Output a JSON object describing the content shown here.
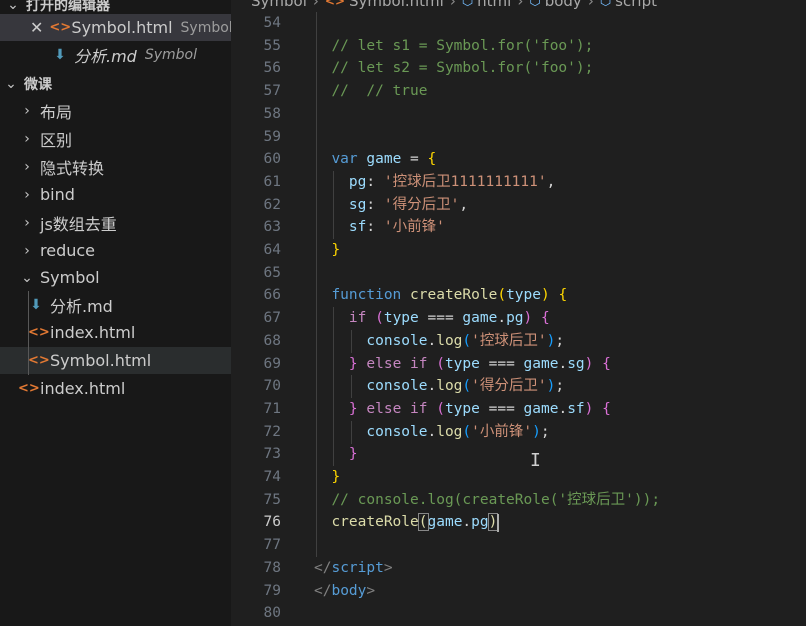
{
  "sidebar": {
    "open_editors_title": "打开的编辑器",
    "open_editors": [
      {
        "icon": "close-icon",
        "type_icon": "html-file-icon",
        "name": "Symbol.html",
        "folder": "Symbol"
      },
      {
        "type_icon": "markdown-file-icon",
        "name": "分析.md",
        "folder": "Symbol"
      }
    ],
    "workspace_title": "微课",
    "tree": [
      {
        "kind": "folder",
        "label": "布局",
        "expanded": false
      },
      {
        "kind": "folder",
        "label": "区别",
        "expanded": false
      },
      {
        "kind": "folder",
        "label": "隐式转换",
        "expanded": false
      },
      {
        "kind": "folder",
        "label": "bind",
        "expanded": false
      },
      {
        "kind": "folder",
        "label": "js数组去重",
        "expanded": false
      },
      {
        "kind": "folder",
        "label": "reduce",
        "expanded": false
      },
      {
        "kind": "folder",
        "label": "Symbol",
        "expanded": true
      },
      {
        "kind": "file",
        "icon": "markdown-file-icon",
        "label": "分析.md"
      },
      {
        "kind": "file",
        "icon": "html-file-icon",
        "label": "index.html"
      },
      {
        "kind": "file",
        "icon": "html-file-icon",
        "label": "Symbol.html",
        "selected": true
      },
      {
        "kind": "file",
        "icon": "html-file-icon",
        "label": "index.html"
      }
    ]
  },
  "breadcrumb": [
    "Symbol",
    "Symbol.html",
    "html",
    "body",
    "script"
  ],
  "editor": {
    "current_line": 76,
    "lines": [
      {
        "n": 54,
        "indent": 2,
        "tokens": []
      },
      {
        "n": 55,
        "indent": 2,
        "tokens": [
          [
            "com",
            "// let s1 = Symbol.for('foo');"
          ]
        ]
      },
      {
        "n": 56,
        "indent": 2,
        "tokens": [
          [
            "com",
            "// let s2 = Symbol.for('foo');"
          ]
        ]
      },
      {
        "n": 57,
        "indent": 2,
        "tokens": [
          [
            "com",
            "//  // true"
          ]
        ]
      },
      {
        "n": 58,
        "indent": 2,
        "tokens": []
      },
      {
        "n": 59,
        "indent": 2,
        "tokens": []
      },
      {
        "n": 60,
        "indent": 2,
        "tokens": [
          [
            "kw",
            "var"
          ],
          [
            "pun",
            " "
          ],
          [
            "var",
            "game"
          ],
          [
            "pun",
            " = "
          ],
          [
            "b1",
            "{"
          ]
        ]
      },
      {
        "n": 61,
        "indent": 3,
        "tokens": [
          [
            "var",
            "pg"
          ],
          [
            "pun",
            ": "
          ],
          [
            "str",
            "'控球后卫1111111111'"
          ],
          [
            "pun",
            ","
          ]
        ]
      },
      {
        "n": 62,
        "indent": 3,
        "tokens": [
          [
            "var",
            "sg"
          ],
          [
            "pun",
            ": "
          ],
          [
            "str",
            "'得分后卫'"
          ],
          [
            "pun",
            ","
          ]
        ]
      },
      {
        "n": 63,
        "indent": 3,
        "tokens": [
          [
            "var",
            "sf"
          ],
          [
            "pun",
            ": "
          ],
          [
            "str",
            "'小前锋'"
          ]
        ]
      },
      {
        "n": 64,
        "indent": 2,
        "tokens": [
          [
            "b1",
            "}"
          ]
        ]
      },
      {
        "n": 65,
        "indent": 2,
        "tokens": []
      },
      {
        "n": 66,
        "indent": 2,
        "tokens": [
          [
            "kw",
            "function"
          ],
          [
            "pun",
            " "
          ],
          [
            "fn",
            "createRole"
          ],
          [
            "b1",
            "("
          ],
          [
            "var",
            "type"
          ],
          [
            "b1",
            ")"
          ],
          [
            "pun",
            " "
          ],
          [
            "b1",
            "{"
          ]
        ]
      },
      {
        "n": 67,
        "indent": 3,
        "tokens": [
          [
            "ctl",
            "if"
          ],
          [
            "pun",
            " "
          ],
          [
            "b2",
            "("
          ],
          [
            "var",
            "type"
          ],
          [
            "pun",
            " === "
          ],
          [
            "var",
            "game"
          ],
          [
            "pun",
            "."
          ],
          [
            "var",
            "pg"
          ],
          [
            "b2",
            ")"
          ],
          [
            "pun",
            " "
          ],
          [
            "b2",
            "{"
          ]
        ]
      },
      {
        "n": 68,
        "indent": 4,
        "tokens": [
          [
            "var",
            "console"
          ],
          [
            "pun",
            "."
          ],
          [
            "fn",
            "log"
          ],
          [
            "b3",
            "("
          ],
          [
            "str",
            "'控球后卫'"
          ],
          [
            "b3",
            ")"
          ],
          [
            "pun",
            ";"
          ]
        ]
      },
      {
        "n": 69,
        "indent": 3,
        "tokens": [
          [
            "b2",
            "}"
          ],
          [
            "pun",
            " "
          ],
          [
            "ctl",
            "else if"
          ],
          [
            "pun",
            " "
          ],
          [
            "b2",
            "("
          ],
          [
            "var",
            "type"
          ],
          [
            "pun",
            " === "
          ],
          [
            "var",
            "game"
          ],
          [
            "pun",
            "."
          ],
          [
            "var",
            "sg"
          ],
          [
            "b2",
            ")"
          ],
          [
            "pun",
            " "
          ],
          [
            "b2",
            "{"
          ]
        ]
      },
      {
        "n": 70,
        "indent": 4,
        "tokens": [
          [
            "var",
            "console"
          ],
          [
            "pun",
            "."
          ],
          [
            "fn",
            "log"
          ],
          [
            "b3",
            "("
          ],
          [
            "str",
            "'得分后卫'"
          ],
          [
            "b3",
            ")"
          ],
          [
            "pun",
            ";"
          ]
        ]
      },
      {
        "n": 71,
        "indent": 3,
        "tokens": [
          [
            "b2",
            "}"
          ],
          [
            "pun",
            " "
          ],
          [
            "ctl",
            "else if"
          ],
          [
            "pun",
            " "
          ],
          [
            "b2",
            "("
          ],
          [
            "var",
            "type"
          ],
          [
            "pun",
            " === "
          ],
          [
            "var",
            "game"
          ],
          [
            "pun",
            "."
          ],
          [
            "var",
            "sf"
          ],
          [
            "b2",
            ")"
          ],
          [
            "pun",
            " "
          ],
          [
            "b2",
            "{"
          ]
        ]
      },
      {
        "n": 72,
        "indent": 4,
        "tokens": [
          [
            "var",
            "console"
          ],
          [
            "pun",
            "."
          ],
          [
            "fn",
            "log"
          ],
          [
            "b3",
            "("
          ],
          [
            "str",
            "'小前锋'"
          ],
          [
            "b3",
            ")"
          ],
          [
            "pun",
            ";"
          ]
        ]
      },
      {
        "n": 73,
        "indent": 3,
        "tokens": [
          [
            "b2",
            "}"
          ]
        ]
      },
      {
        "n": 74,
        "indent": 2,
        "tokens": [
          [
            "b1",
            "}"
          ]
        ]
      },
      {
        "n": 75,
        "indent": 2,
        "tokens": [
          [
            "com",
            "// console.log(createRole('控球后卫'));"
          ]
        ]
      },
      {
        "n": 76,
        "indent": 2,
        "tokens": [
          [
            "fn",
            "createRole"
          ],
          [
            "box",
            "("
          ],
          [
            "var",
            "game"
          ],
          [
            "pun",
            "."
          ],
          [
            "var",
            "pg"
          ],
          [
            "box",
            ")"
          ]
        ]
      },
      {
        "n": 77,
        "indent": 2,
        "tokens": []
      },
      {
        "n": 78,
        "indent": 1,
        "tokens": [
          [
            "tagb",
            "</"
          ],
          [
            "tag",
            "script"
          ],
          [
            "tagb",
            ">"
          ]
        ]
      },
      {
        "n": 79,
        "indent": 0,
        "tokens": [
          [
            "tagb",
            "</"
          ],
          [
            "tag",
            "body"
          ],
          [
            "tagb",
            ">"
          ]
        ]
      },
      {
        "n": 80,
        "indent": 0,
        "tokens": []
      }
    ]
  }
}
